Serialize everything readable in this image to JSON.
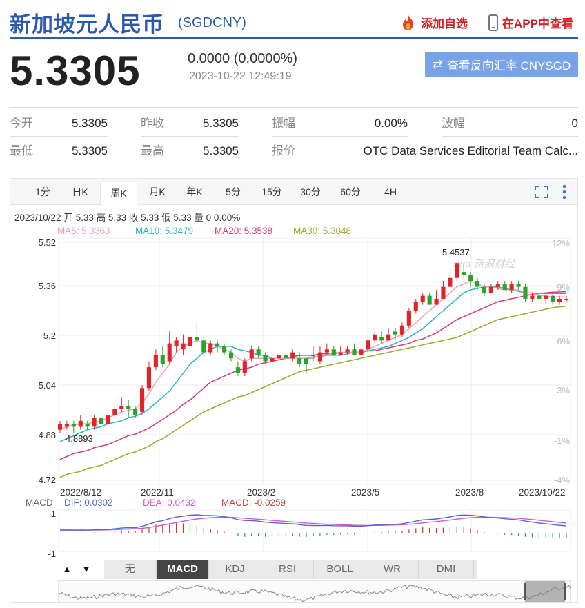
{
  "header": {
    "title": "新加坡元人民币",
    "code": "(SGDCNY)",
    "add_watch": "添加自选",
    "view_app": "在APP中查看"
  },
  "quote": {
    "price": "5.3305",
    "change": "0.0000 (0.0000%)",
    "time": "2023-10-22 12:49:19",
    "reverse_btn": "查看反向汇率 CNYSGD"
  },
  "stats": {
    "row1": [
      {
        "label": "今开",
        "value": "5.3305"
      },
      {
        "label": "昨收",
        "value": "5.3305"
      },
      {
        "label": "振幅",
        "value": "0.00%"
      },
      {
        "label": "波幅",
        "value": "0"
      }
    ],
    "row2": [
      {
        "label": "最低",
        "value": "5.3305"
      },
      {
        "label": "最高",
        "value": "5.3305"
      },
      {
        "label": "报价",
        "value": "OTC Data Services Editorial Team Calc..."
      }
    ]
  },
  "tabs": [
    "1分",
    "日K",
    "周K",
    "月K",
    "年K",
    "5分",
    "15分",
    "30分",
    "60分",
    "4H"
  ],
  "active_tab": "周K",
  "chart_info": "2023/10/22 开 5.33 高 5.33 收 5.33 低 5.33 量 0 0.00%",
  "ma_labels": [
    {
      "text": "MA5: 5.3363",
      "color": "#f0a0b4"
    },
    {
      "text": "MA10: 5.3479",
      "color": "#2bb3c8"
    },
    {
      "text": "MA20: 5.3538",
      "color": "#d13b6a"
    },
    {
      "text": "MA30: 5.3048",
      "color": "#9aaa2a"
    }
  ],
  "macd_labels": {
    "title": "MACD",
    "dif": "DIF: 0.0302",
    "dea": "DEA: 0.0432",
    "macd": "MACD: -0.0259"
  },
  "indicator_tabs": [
    "无",
    "MACD",
    "KDJ",
    "RSI",
    "BOLL",
    "WR",
    "DMI"
  ],
  "active_indicator": "MACD",
  "nav_buttons": {
    "up": "▲",
    "down": "▼"
  },
  "watermark": "sina 新浪财经",
  "colors": {
    "brand": "#2b5aa8",
    "up": "#e0242a",
    "down": "#2aa32a",
    "ma5": "#f0a0b4",
    "ma10": "#2bb3c8",
    "ma20": "#d13b6a",
    "ma30": "#9aaa2a",
    "dif": "#5566cc",
    "dea": "#d656d6"
  },
  "chart_data": {
    "type": "candlestick",
    "y_ticks": [
      "5.52",
      "5.36",
      "5.2",
      "5.04",
      "4.88",
      "4.72"
    ],
    "y_right_ticks": [
      "12%",
      "9%",
      "6%",
      "3%",
      "-1%",
      "-4%"
    ],
    "x_ticks": [
      "2022/8/12",
      "2022/11",
      "2023/2",
      "2023/5",
      "2023/8",
      "2023/10/22"
    ],
    "ylim": [
      4.72,
      5.52
    ],
    "high_label": "5.4537",
    "low_label": "4.8893",
    "macd_ticks": [
      "1",
      "-1"
    ],
    "candles": [
      [
        4.89,
        4.91,
        4.92,
        4.88
      ],
      [
        4.9,
        4.91,
        4.92,
        4.89
      ],
      [
        4.91,
        4.9,
        4.92,
        4.88
      ],
      [
        4.9,
        4.92,
        4.94,
        4.89
      ],
      [
        4.91,
        4.9,
        4.92,
        4.89
      ],
      [
        4.9,
        4.93,
        4.94,
        4.89
      ],
      [
        4.93,
        4.91,
        4.93,
        4.9
      ],
      [
        4.91,
        4.94,
        4.96,
        4.9
      ],
      [
        4.94,
        4.96,
        4.97,
        4.93
      ],
      [
        4.96,
        4.97,
        5.0,
        4.95
      ],
      [
        4.97,
        4.96,
        4.99,
        4.93
      ],
      [
        4.96,
        4.94,
        4.97,
        4.93
      ],
      [
        4.95,
        5.03,
        5.04,
        4.94
      ],
      [
        5.03,
        5.1,
        5.12,
        5.02
      ],
      [
        5.1,
        5.14,
        5.16,
        5.09
      ],
      [
        5.14,
        5.11,
        5.17,
        5.1
      ],
      [
        5.12,
        5.18,
        5.22,
        5.11
      ],
      [
        5.17,
        5.19,
        5.2,
        5.15
      ],
      [
        5.16,
        5.18,
        5.21,
        5.14
      ],
      [
        5.17,
        5.2,
        5.22,
        5.16
      ],
      [
        5.2,
        5.19,
        5.25,
        5.18
      ],
      [
        5.19,
        5.15,
        5.2,
        5.14
      ],
      [
        5.15,
        5.18,
        5.19,
        5.14
      ],
      [
        5.18,
        5.17,
        5.19,
        5.15
      ],
      [
        5.17,
        5.15,
        5.18,
        5.14
      ],
      [
        5.15,
        5.13,
        5.16,
        5.12
      ],
      [
        5.1,
        5.08,
        5.12,
        5.07
      ],
      [
        5.08,
        5.12,
        5.13,
        5.07
      ],
      [
        5.13,
        5.16,
        5.17,
        5.12
      ],
      [
        5.16,
        5.14,
        5.17,
        5.13
      ],
      [
        5.14,
        5.12,
        5.15,
        5.11
      ],
      [
        5.12,
        5.13,
        5.14,
        5.12
      ],
      [
        5.13,
        5.14,
        5.15,
        5.12
      ],
      [
        5.14,
        5.13,
        5.15,
        5.12
      ],
      [
        5.13,
        5.15,
        5.16,
        5.12
      ],
      [
        5.13,
        5.11,
        5.15,
        5.1
      ],
      [
        5.13,
        5.11,
        5.12,
        5.08
      ],
      [
        5.14,
        5.14,
        5.17,
        5.12
      ],
      [
        5.12,
        5.15,
        5.17,
        5.11
      ],
      [
        5.15,
        5.16,
        5.18,
        5.14
      ],
      [
        5.16,
        5.14,
        5.17,
        5.14
      ],
      [
        5.14,
        5.15,
        5.17,
        5.14
      ],
      [
        5.15,
        5.16,
        5.17,
        5.14
      ],
      [
        5.16,
        5.14,
        5.18,
        5.15
      ],
      [
        5.14,
        5.16,
        5.17,
        5.14
      ],
      [
        5.16,
        5.19,
        5.2,
        5.15
      ],
      [
        5.19,
        5.21,
        5.22,
        5.18
      ],
      [
        5.2,
        5.19,
        5.22,
        5.18
      ],
      [
        5.19,
        5.21,
        5.23,
        5.19
      ],
      [
        5.22,
        5.21,
        5.23,
        5.19
      ],
      [
        5.21,
        5.24,
        5.25,
        5.2
      ],
      [
        5.24,
        5.29,
        5.3,
        5.23
      ],
      [
        5.29,
        5.32,
        5.33,
        5.28
      ],
      [
        5.32,
        5.34,
        5.35,
        5.31
      ],
      [
        5.34,
        5.31,
        5.35,
        5.31
      ],
      [
        5.31,
        5.33,
        5.36,
        5.31
      ],
      [
        5.33,
        5.37,
        5.39,
        5.33
      ],
      [
        5.37,
        5.4,
        5.42,
        5.37
      ],
      [
        5.4,
        5.45,
        5.45,
        5.39
      ],
      [
        5.42,
        5.41,
        5.45,
        5.4
      ],
      [
        5.41,
        5.39,
        5.42,
        5.37
      ],
      [
        5.39,
        5.37,
        5.4,
        5.36
      ],
      [
        5.37,
        5.35,
        5.38,
        5.34
      ],
      [
        5.35,
        5.37,
        5.38,
        5.35
      ],
      [
        5.37,
        5.38,
        5.39,
        5.36
      ],
      [
        5.38,
        5.36,
        5.39,
        5.36
      ],
      [
        5.36,
        5.38,
        5.39,
        5.35
      ],
      [
        5.38,
        5.37,
        5.39,
        5.36
      ],
      [
        5.37,
        5.33,
        5.38,
        5.32
      ],
      [
        5.33,
        5.34,
        5.35,
        5.32
      ],
      [
        5.34,
        5.33,
        5.35,
        5.32
      ],
      [
        5.33,
        5.34,
        5.35,
        5.31
      ],
      [
        5.34,
        5.32,
        5.35,
        5.31
      ],
      [
        5.32,
        5.33,
        5.34,
        5.31
      ],
      [
        5.33,
        5.33,
        5.34,
        5.32
      ]
    ],
    "ma5": [
      4.89,
      4.9,
      4.905,
      4.91,
      4.91,
      4.915,
      4.92,
      4.93,
      4.94,
      4.95,
      4.955,
      4.96,
      4.98,
      5.01,
      5.05,
      5.08,
      5.11,
      5.15,
      5.17,
      5.18,
      5.19,
      5.18,
      5.18,
      5.17,
      5.16,
      5.15,
      5.13,
      5.12,
      5.13,
      5.13,
      5.13,
      5.13,
      5.13,
      5.13,
      5.13,
      5.13,
      5.13,
      5.13,
      5.14,
      5.14,
      5.15,
      5.15,
      5.15,
      5.15,
      5.15,
      5.16,
      5.17,
      5.18,
      5.19,
      5.2,
      5.21,
      5.23,
      5.25,
      5.27,
      5.29,
      5.31,
      5.33,
      5.35,
      5.37,
      5.38,
      5.39,
      5.38,
      5.37,
      5.37,
      5.365,
      5.36,
      5.36,
      5.36,
      5.35,
      5.35,
      5.34,
      5.34,
      5.335,
      5.336,
      5.336
    ],
    "ma10": [
      4.85,
      4.86,
      4.87,
      4.88,
      4.89,
      4.895,
      4.9,
      4.91,
      4.915,
      4.92,
      4.93,
      4.935,
      4.945,
      4.96,
      4.98,
      5.0,
      5.02,
      5.05,
      5.08,
      5.11,
      5.13,
      5.15,
      5.16,
      5.17,
      5.17,
      5.17,
      5.16,
      5.155,
      5.15,
      5.14,
      5.14,
      5.13,
      5.13,
      5.13,
      5.13,
      5.13,
      5.13,
      5.135,
      5.135,
      5.14,
      5.14,
      5.14,
      5.145,
      5.15,
      5.15,
      5.155,
      5.16,
      5.165,
      5.17,
      5.18,
      5.19,
      5.2,
      5.215,
      5.23,
      5.25,
      5.27,
      5.29,
      5.31,
      5.33,
      5.35,
      5.36,
      5.365,
      5.37,
      5.37,
      5.37,
      5.365,
      5.36,
      5.355,
      5.35,
      5.35,
      5.348,
      5.348,
      5.348,
      5.348,
      5.348
    ],
    "ma20": [
      4.79,
      4.8,
      4.81,
      4.815,
      4.82,
      4.83,
      4.835,
      4.84,
      4.85,
      4.86,
      4.87,
      4.875,
      4.885,
      4.895,
      4.91,
      4.925,
      4.94,
      4.955,
      4.975,
      4.99,
      5.01,
      5.03,
      5.05,
      5.06,
      5.07,
      5.08,
      5.09,
      5.095,
      5.1,
      5.11,
      5.115,
      5.12,
      5.125,
      5.13,
      5.135,
      5.14,
      5.14,
      5.14,
      5.145,
      5.145,
      5.145,
      5.15,
      5.15,
      5.15,
      5.15,
      5.155,
      5.155,
      5.16,
      5.165,
      5.17,
      5.175,
      5.18,
      5.19,
      5.195,
      5.205,
      5.215,
      5.23,
      5.245,
      5.26,
      5.27,
      5.28,
      5.29,
      5.3,
      5.31,
      5.32,
      5.325,
      5.33,
      5.335,
      5.34,
      5.345,
      5.348,
      5.35,
      5.352,
      5.353,
      5.354
    ],
    "ma30": [
      4.73,
      4.74,
      4.745,
      4.75,
      4.76,
      4.765,
      4.77,
      4.78,
      4.79,
      4.8,
      4.81,
      4.815,
      4.825,
      4.835,
      4.85,
      4.86,
      4.875,
      4.89,
      4.905,
      4.92,
      4.935,
      4.95,
      4.96,
      4.97,
      4.98,
      4.99,
      5.0,
      5.005,
      5.015,
      5.025,
      5.035,
      5.045,
      5.055,
      5.065,
      5.075,
      5.085,
      5.09,
      5.095,
      5.1,
      5.105,
      5.11,
      5.115,
      5.12,
      5.125,
      5.13,
      5.135,
      5.14,
      5.145,
      5.15,
      5.155,
      5.16,
      5.165,
      5.17,
      5.175,
      5.18,
      5.185,
      5.19,
      5.195,
      5.2,
      5.21,
      5.22,
      5.23,
      5.24,
      5.25,
      5.26,
      5.265,
      5.27,
      5.275,
      5.28,
      5.285,
      5.29,
      5.295,
      5.3,
      5.303,
      5.305
    ]
  }
}
